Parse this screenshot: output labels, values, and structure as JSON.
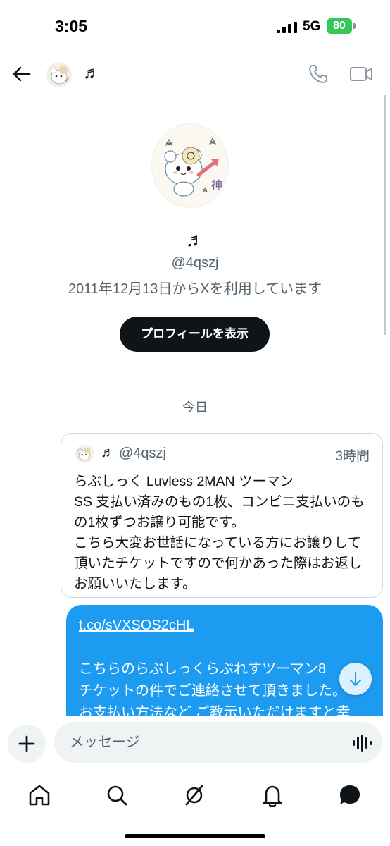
{
  "status_bar": {
    "time": "3:05",
    "network": "5G",
    "battery": "80"
  },
  "header": {
    "name": "♬",
    "icons": [
      "back-arrow-icon",
      "phone-icon",
      "video-icon"
    ]
  },
  "profile": {
    "name": "♬",
    "handle": "@4qszj",
    "since": "2011年12月13日からXを利用しています",
    "view_profile_button": "プロフィールを表示"
  },
  "conversation": {
    "date_separator": "今日",
    "quoted_post": {
      "name": "♬",
      "handle": "@4qszj",
      "time": "3時間",
      "text": "らぶしっく Luvless 2MAN ツーマン\nSS 支払い済みのもの1枚、コンビニ支払いのもの1枚ずつお譲り可能です。\nこちら大変お世話になっている方にお譲りして頂いたチケットですので何かあった際はお返しお願いいたします。"
    },
    "message": {
      "link": "t.co/sVXSOS2cHL",
      "text": "こちらのらぶしっくらぶれすツーマン8\nチケットの件でご連絡させて頂きました。\nお支払い方法など ご教示いただけますと幸"
    }
  },
  "composer": {
    "placeholder": "メッセージ"
  },
  "bottom_nav": {
    "items": [
      "home-icon",
      "search-icon",
      "grok-icon",
      "notifications-icon",
      "messages-icon"
    ]
  },
  "colors": {
    "accent": "#1d9bf0",
    "text": "#0f1419",
    "secondary": "#536471",
    "button_dark": "#0f1419",
    "battery": "#34c759"
  }
}
